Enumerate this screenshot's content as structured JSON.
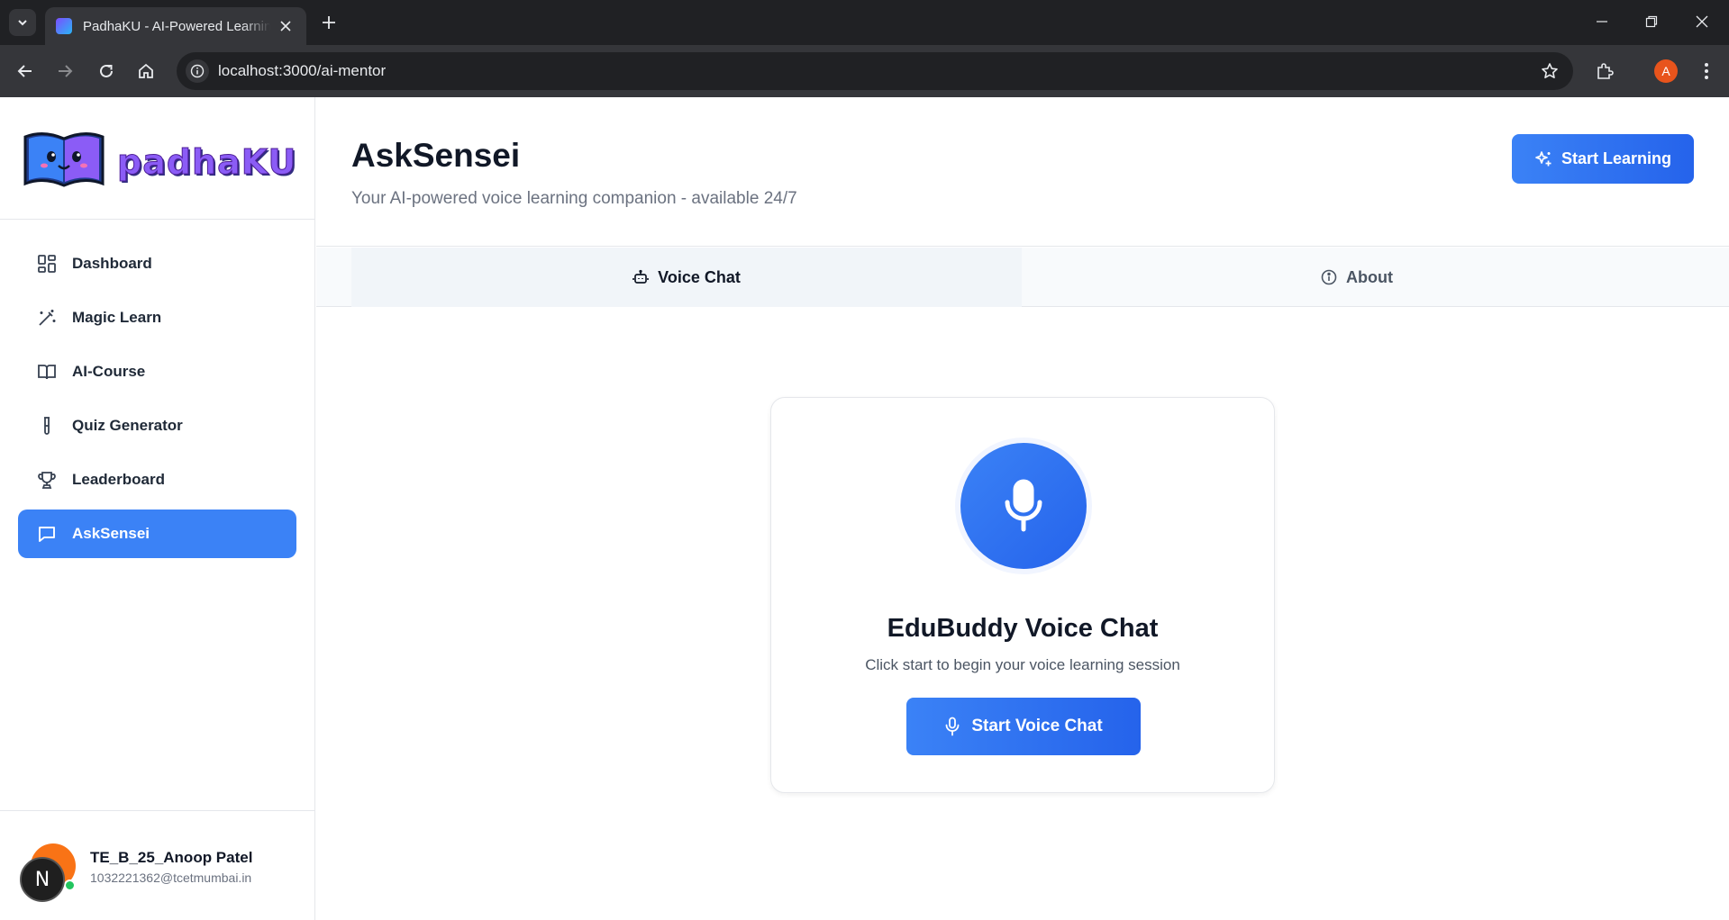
{
  "browser": {
    "tab_title": "PadhaKU - AI-Powered Learning",
    "url": "localhost:3000/ai-mentor",
    "profile_initial": "A"
  },
  "brand": {
    "name": "padhaKU"
  },
  "sidebar": {
    "items": [
      {
        "label": "Dashboard",
        "icon": "dashboard-grid-icon"
      },
      {
        "label": "Magic Learn",
        "icon": "magic-wand-icon"
      },
      {
        "label": "AI-Course",
        "icon": "book-open-icon"
      },
      {
        "label": "Quiz Generator",
        "icon": "test-tube-icon"
      },
      {
        "label": "Leaderboard",
        "icon": "trophy-icon"
      },
      {
        "label": "AskSensei",
        "icon": "message-square-icon",
        "active": true
      }
    ]
  },
  "user": {
    "name": "TE_B_25_Anoop Patel",
    "email": "1032221362@tcetmumbai.in"
  },
  "header": {
    "title": "AskSensei",
    "subtitle": "Your AI-powered voice learning companion - available 24/7",
    "cta_label": "Start Learning"
  },
  "tabs": {
    "voice_chat": "Voice Chat",
    "about": "About"
  },
  "card": {
    "title": "EduBuddy Voice Chat",
    "subtitle": "Click start to begin your voice learning session",
    "button_label": "Start Voice Chat"
  },
  "floating_badge": "N",
  "colors": {
    "accent": "#3b82f6",
    "accent_dark": "#2563eb",
    "online": "#22c55e",
    "avatar": "#f97316"
  }
}
